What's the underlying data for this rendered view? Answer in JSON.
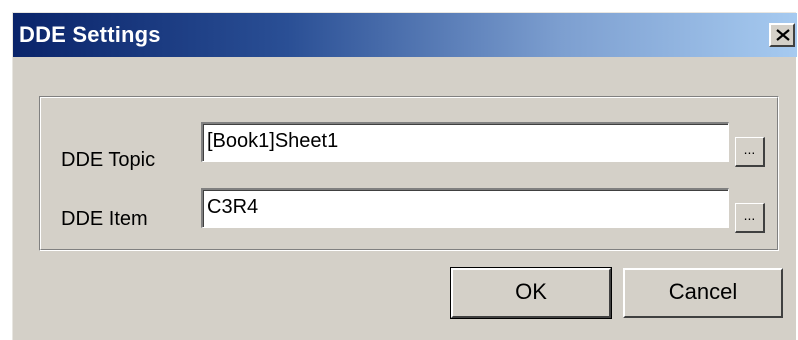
{
  "window": {
    "title": "DDE Settings",
    "close_glyph": "close-icon"
  },
  "form": {
    "topic_label": "DDE Topic",
    "topic_value": "[Book1]Sheet1",
    "item_label": "DDE Item",
    "item_value": "C3R4",
    "browse_label": "..."
  },
  "buttons": {
    "ok_label": "OK",
    "cancel_label": "Cancel"
  },
  "colors": {
    "face": "#d4d0c8",
    "title_start": "#0a246a",
    "title_end": "#a6caf0"
  }
}
